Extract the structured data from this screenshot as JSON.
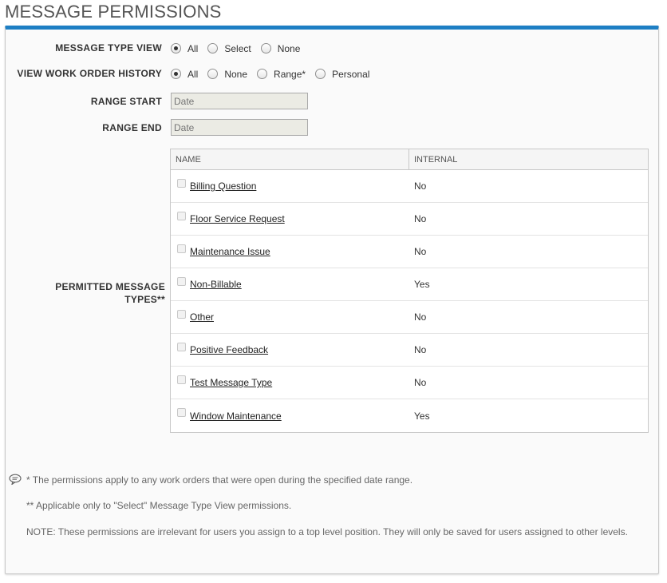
{
  "page": {
    "title": "MESSAGE PERMISSIONS"
  },
  "message_type_view": {
    "label": "MESSAGE TYPE VIEW",
    "options": [
      {
        "label": "All",
        "checked": true
      },
      {
        "label": "Select",
        "checked": false
      },
      {
        "label": "None",
        "checked": false
      }
    ]
  },
  "work_order_history": {
    "label": "VIEW WORK ORDER HISTORY",
    "options": [
      {
        "label": "All",
        "checked": true
      },
      {
        "label": "None",
        "checked": false
      },
      {
        "label": "Range*",
        "checked": false
      },
      {
        "label": "Personal",
        "checked": false
      }
    ]
  },
  "range_start": {
    "label": "RANGE START",
    "placeholder": "Date"
  },
  "range_end": {
    "label": "RANGE END",
    "placeholder": "Date"
  },
  "permitted": {
    "label_line1": "PERMITTED MESSAGE",
    "label_line2": "TYPES**",
    "columns": {
      "name": "NAME",
      "internal": "INTERNAL"
    },
    "rows": [
      {
        "name": "Billing Question",
        "internal": "No"
      },
      {
        "name": "Floor Service Request",
        "internal": "No"
      },
      {
        "name": "Maintenance Issue",
        "internal": "No"
      },
      {
        "name": "Non-Billable",
        "internal": "Yes"
      },
      {
        "name": "Other",
        "internal": "No"
      },
      {
        "name": "Positive Feedback",
        "internal": "No"
      },
      {
        "name": "Test Message Type",
        "internal": "No"
      },
      {
        "name": "Window Maintenance",
        "internal": "Yes"
      }
    ]
  },
  "notes": {
    "icon": "speech-bubble-icon",
    "note1": "* The permissions apply to any work orders that were open during the specified date range.",
    "note2": "** Applicable only to \"Select\" Message Type View permissions.",
    "note3": "NOTE: These permissions are irrelevant for users you assign to a top level position. They will only be saved for users assigned to other levels."
  },
  "colors": {
    "accent": "#1e7fc4"
  }
}
